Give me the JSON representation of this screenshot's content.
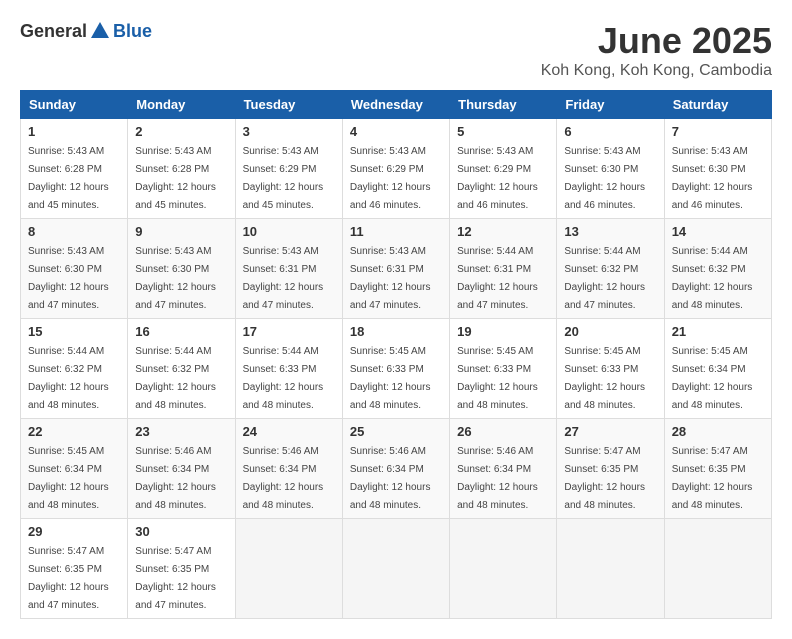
{
  "logo": {
    "general": "General",
    "blue": "Blue"
  },
  "title": "June 2025",
  "subtitle": "Koh Kong, Koh Kong, Cambodia",
  "weekdays": [
    "Sunday",
    "Monday",
    "Tuesday",
    "Wednesday",
    "Thursday",
    "Friday",
    "Saturday"
  ],
  "weeks": [
    [
      {
        "day": "1",
        "sunrise": "5:43 AM",
        "sunset": "6:28 PM",
        "daylight": "12 hours and 45 minutes."
      },
      {
        "day": "2",
        "sunrise": "5:43 AM",
        "sunset": "6:28 PM",
        "daylight": "12 hours and 45 minutes."
      },
      {
        "day": "3",
        "sunrise": "5:43 AM",
        "sunset": "6:29 PM",
        "daylight": "12 hours and 45 minutes."
      },
      {
        "day": "4",
        "sunrise": "5:43 AM",
        "sunset": "6:29 PM",
        "daylight": "12 hours and 46 minutes."
      },
      {
        "day": "5",
        "sunrise": "5:43 AM",
        "sunset": "6:29 PM",
        "daylight": "12 hours and 46 minutes."
      },
      {
        "day": "6",
        "sunrise": "5:43 AM",
        "sunset": "6:30 PM",
        "daylight": "12 hours and 46 minutes."
      },
      {
        "day": "7",
        "sunrise": "5:43 AM",
        "sunset": "6:30 PM",
        "daylight": "12 hours and 46 minutes."
      }
    ],
    [
      {
        "day": "8",
        "sunrise": "5:43 AM",
        "sunset": "6:30 PM",
        "daylight": "12 hours and 47 minutes."
      },
      {
        "day": "9",
        "sunrise": "5:43 AM",
        "sunset": "6:30 PM",
        "daylight": "12 hours and 47 minutes."
      },
      {
        "day": "10",
        "sunrise": "5:43 AM",
        "sunset": "6:31 PM",
        "daylight": "12 hours and 47 minutes."
      },
      {
        "day": "11",
        "sunrise": "5:43 AM",
        "sunset": "6:31 PM",
        "daylight": "12 hours and 47 minutes."
      },
      {
        "day": "12",
        "sunrise": "5:44 AM",
        "sunset": "6:31 PM",
        "daylight": "12 hours and 47 minutes."
      },
      {
        "day": "13",
        "sunrise": "5:44 AM",
        "sunset": "6:32 PM",
        "daylight": "12 hours and 47 minutes."
      },
      {
        "day": "14",
        "sunrise": "5:44 AM",
        "sunset": "6:32 PM",
        "daylight": "12 hours and 48 minutes."
      }
    ],
    [
      {
        "day": "15",
        "sunrise": "5:44 AM",
        "sunset": "6:32 PM",
        "daylight": "12 hours and 48 minutes."
      },
      {
        "day": "16",
        "sunrise": "5:44 AM",
        "sunset": "6:32 PM",
        "daylight": "12 hours and 48 minutes."
      },
      {
        "day": "17",
        "sunrise": "5:44 AM",
        "sunset": "6:33 PM",
        "daylight": "12 hours and 48 minutes."
      },
      {
        "day": "18",
        "sunrise": "5:45 AM",
        "sunset": "6:33 PM",
        "daylight": "12 hours and 48 minutes."
      },
      {
        "day": "19",
        "sunrise": "5:45 AM",
        "sunset": "6:33 PM",
        "daylight": "12 hours and 48 minutes."
      },
      {
        "day": "20",
        "sunrise": "5:45 AM",
        "sunset": "6:33 PM",
        "daylight": "12 hours and 48 minutes."
      },
      {
        "day": "21",
        "sunrise": "5:45 AM",
        "sunset": "6:34 PM",
        "daylight": "12 hours and 48 minutes."
      }
    ],
    [
      {
        "day": "22",
        "sunrise": "5:45 AM",
        "sunset": "6:34 PM",
        "daylight": "12 hours and 48 minutes."
      },
      {
        "day": "23",
        "sunrise": "5:46 AM",
        "sunset": "6:34 PM",
        "daylight": "12 hours and 48 minutes."
      },
      {
        "day": "24",
        "sunrise": "5:46 AM",
        "sunset": "6:34 PM",
        "daylight": "12 hours and 48 minutes."
      },
      {
        "day": "25",
        "sunrise": "5:46 AM",
        "sunset": "6:34 PM",
        "daylight": "12 hours and 48 minutes."
      },
      {
        "day": "26",
        "sunrise": "5:46 AM",
        "sunset": "6:34 PM",
        "daylight": "12 hours and 48 minutes."
      },
      {
        "day": "27",
        "sunrise": "5:47 AM",
        "sunset": "6:35 PM",
        "daylight": "12 hours and 48 minutes."
      },
      {
        "day": "28",
        "sunrise": "5:47 AM",
        "sunset": "6:35 PM",
        "daylight": "12 hours and 48 minutes."
      }
    ],
    [
      {
        "day": "29",
        "sunrise": "5:47 AM",
        "sunset": "6:35 PM",
        "daylight": "12 hours and 47 minutes."
      },
      {
        "day": "30",
        "sunrise": "5:47 AM",
        "sunset": "6:35 PM",
        "daylight": "12 hours and 47 minutes."
      },
      null,
      null,
      null,
      null,
      null
    ]
  ],
  "labels": {
    "sunrise": "Sunrise:",
    "sunset": "Sunset:",
    "daylight": "Daylight:"
  }
}
